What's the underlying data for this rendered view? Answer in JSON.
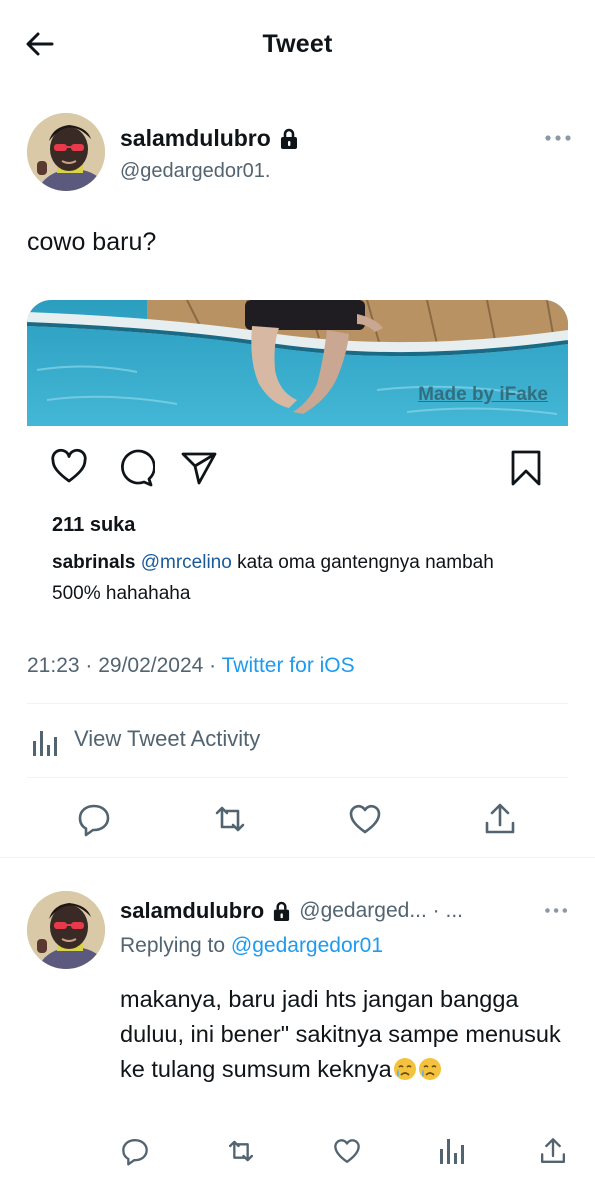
{
  "header": {
    "title": "Tweet"
  },
  "tweet": {
    "author_name": "salamdulubro",
    "author_handle": "@gedargedor01.",
    "text": "cowo baru?",
    "timestamp": "21:23 · 29/02/2024",
    "meta_separator": " · ",
    "source": "Twitter for iOS",
    "activity_label": "View Tweet Activity"
  },
  "embedded_post": {
    "watermark": "Made by iFake",
    "likes": "211 suka",
    "caption_user": "sabrinals",
    "caption_mention": "@mrcelino",
    "caption_text": " kata oma gantengnya nambah 500% hahahaha"
  },
  "reply": {
    "author_name": "salamdulubro",
    "author_handle_truncated": "@gedarged... · ...",
    "replying_prefix": "Replying to ",
    "replying_to": "@gedargedor01",
    "text": "makanya, baru jadi hts jangan bangga duluu, ini bener\" sakitnya sampe menusuk ke tulang sumsum keknya"
  },
  "icons": {
    "back": "arrow-left-icon",
    "lock": "lock-icon",
    "more": "more-horizontal-icon",
    "ig_like": "heart-outline-icon",
    "ig_comment": "comment-bubble-icon",
    "ig_send": "paper-plane-icon",
    "ig_save": "bookmark-icon",
    "activity": "bar-chart-icon",
    "reply": "reply-icon",
    "retweet": "retweet-icon",
    "like": "heart-icon",
    "share": "share-icon",
    "emoji": "crying-face-emoji"
  },
  "colors": {
    "link": "#1d9bf0",
    "secondary_text": "#536471",
    "divider": "#eff3f4",
    "icon": "#536471"
  }
}
